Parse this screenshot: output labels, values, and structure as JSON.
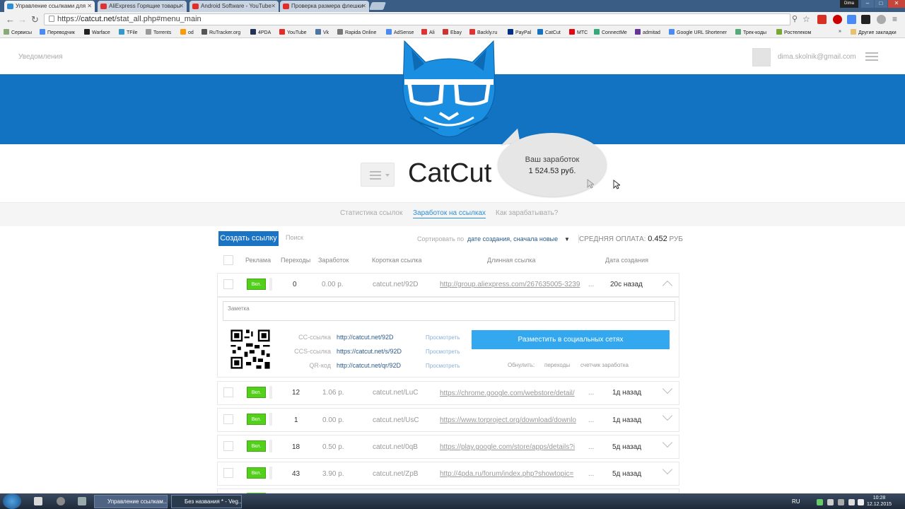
{
  "browser": {
    "tabs": [
      {
        "label": "Управление ссылками для",
        "active": true,
        "color": "#2d8fd6"
      },
      {
        "label": "AliExpress Горящие товары",
        "active": false,
        "color": "#d33"
      },
      {
        "label": "Android Software - YouTube",
        "active": false,
        "color": "#e52d27"
      },
      {
        "label": "Проверка размера флешки",
        "active": false,
        "color": "#e52d27"
      }
    ],
    "profile": "Dima",
    "url_scheme": "https://",
    "url_host": "catcut.net",
    "url_path": "/stat_all.php#menu_main",
    "bookmarks": [
      {
        "label": "Сервисы",
        "color": "#5a9"
      },
      {
        "label": "Переводчик",
        "color": "#4a8af4"
      },
      {
        "label": "Warface",
        "color": "#222"
      },
      {
        "label": "TFile",
        "color": "#39c"
      },
      {
        "label": "Torrents",
        "color": "#999"
      },
      {
        "label": "od",
        "color": "#f90"
      },
      {
        "label": "RuTracker.org",
        "color": "#555"
      },
      {
        "label": "4PDA",
        "color": "#235"
      },
      {
        "label": "YouTube",
        "color": "#e52d27"
      },
      {
        "label": "Vk",
        "color": "#4c75a3"
      },
      {
        "label": "Rapida Online",
        "color": "#777"
      },
      {
        "label": "AdSense",
        "color": "#4a8af4"
      },
      {
        "label": "Ali",
        "color": "#d33"
      },
      {
        "label": "Ebay",
        "color": "#c33"
      },
      {
        "label": "Backly.ru",
        "color": "#d33"
      },
      {
        "label": "PayPal",
        "color": "#003087"
      },
      {
        "label": "CatCut",
        "color": "#1173c1"
      },
      {
        "label": "МТС",
        "color": "#e30611"
      },
      {
        "label": "ConnectMe",
        "color": "#3a7"
      },
      {
        "label": "admitad",
        "color": "#639"
      },
      {
        "label": "Google URL Shortener",
        "color": "#4a8af4"
      },
      {
        "label": "Трек-коды",
        "color": "#5a7"
      },
      {
        "label": "Ростелеком",
        "color": "#7a3"
      }
    ],
    "bookmarks_more": "»",
    "other_bookmarks": "Другие закладки"
  },
  "header": {
    "notifications": "Уведомления",
    "email": "dima.skolnik@gmail.com"
  },
  "brand": {
    "name": "CatCut",
    "earnings_label": "Ваш заработок",
    "earnings_value": "1 524.53 руб."
  },
  "subnav": [
    "Статистика ссылок",
    "Заработок на ссылках",
    "Как зарабатывать?"
  ],
  "controls": {
    "create": "Создать ссылку",
    "search": "Поиск",
    "sort_label": "Сортировать по",
    "sort_value": "дате создания, сначала новые",
    "avg_label": "СРЕДНЯЯ ОПЛАТА:",
    "avg_value": "0.452",
    "avg_unit": "РУБ"
  },
  "columns": [
    "Реклама",
    "Переходы",
    "Заработок",
    "Короткая ссылка",
    "Длинная ссылка",
    "Дата создания"
  ],
  "rows": [
    {
      "ad": "Вкл.",
      "clicks": "0",
      "earn": "0.00 р.",
      "short": "catcut.net/92D",
      "long": "http://group.aliexpress.com/267635005-3239",
      "more": "...",
      "date": "20с назад",
      "expanded": true
    },
    {
      "ad": "Вкл.",
      "clicks": "12",
      "earn": "1.06 р.",
      "short": "catcut.net/LuC",
      "long": "https://chrome.google.com/webstore/detail/",
      "more": "...",
      "date": "1д назад",
      "expanded": false
    },
    {
      "ad": "Вкл.",
      "clicks": "1",
      "earn": "0.00 р.",
      "short": "catcut.net/UsC",
      "long": "https://www.torproject.org/download/downlo",
      "more": "...",
      "date": "1д назад",
      "expanded": false
    },
    {
      "ad": "Вкл.",
      "clicks": "18",
      "earn": "0.50 р.",
      "short": "catcut.net/0qB",
      "long": "https://play.google.com/store/apps/details?i",
      "more": "...",
      "date": "5д назад",
      "expanded": false
    },
    {
      "ad": "Вкл.",
      "clicks": "43",
      "earn": "3.90 р.",
      "short": "catcut.net/ZpB",
      "long": "http://4pda.ru/forum/index.php?showtopic=",
      "more": "...",
      "date": "5д назад",
      "expanded": false
    }
  ],
  "detail": {
    "note_placeholder": "Заметка",
    "links": [
      {
        "label": "CC-ссылка",
        "url": "http://catcut.net/92D",
        "view": "Просмотреть"
      },
      {
        "label": "CCS-ссылка",
        "url": "https://catcut.net/s/92D",
        "view": "Просмотреть"
      },
      {
        "label": "QR-код",
        "url": "http://catcut.net/qr/92D",
        "view": "Просмотреть"
      }
    ],
    "social": "Разместить в социальных сетях",
    "actions": [
      "Обнулить:",
      "переходы",
      "счетчик заработка"
    ]
  },
  "taskbar": {
    "buttons": [
      "Управление ссылкам...",
      "Без названия * - Veg..."
    ],
    "lang": "RU",
    "time": "10:28",
    "date": "12.12.2015"
  }
}
